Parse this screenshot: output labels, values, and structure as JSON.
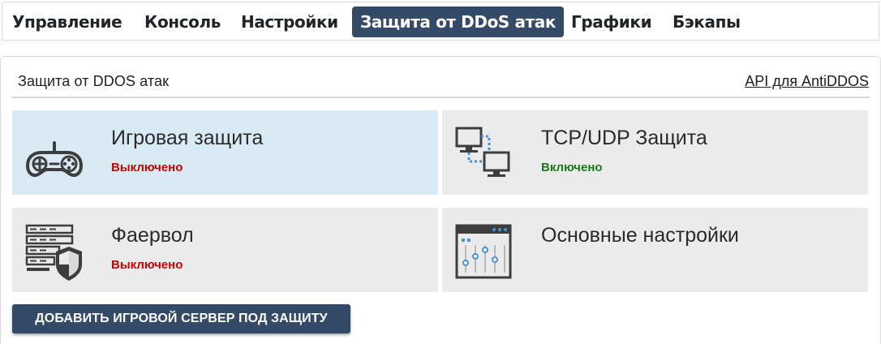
{
  "nav": {
    "items": [
      {
        "label": "Управление"
      },
      {
        "label": "Консоль"
      },
      {
        "label": "Настройки"
      },
      {
        "label": "Защита от DDoS атак",
        "active": true
      },
      {
        "label": "Графики"
      },
      {
        "label": "Бэкапы"
      }
    ]
  },
  "panel": {
    "title": "Защита от DDOS атак",
    "api_link": "API для AntiDDOS"
  },
  "tiles": [
    {
      "title": "Игровая защита",
      "status": "Выключено",
      "icon": "gamepad-icon",
      "highlighted": true
    },
    {
      "title": "TCP/UDP Защита",
      "status": "Включено",
      "icon": "network-computers-icon"
    },
    {
      "title": "Фаервол",
      "status": "Выключено",
      "icon": "firewall-shield-icon"
    },
    {
      "title": "Основные настройки",
      "icon": "settings-sliders-icon"
    }
  ],
  "add_button": {
    "label": "ДОБАВИТЬ ИГРОВОЙ СЕРВЕР ПОД ЗАЩИТУ"
  },
  "colors": {
    "accent": "#344b67",
    "tile_bg": "#ebebeb",
    "tile_highlight": "#d8ebf5",
    "status_off": "#cc0000",
    "status_on": "#1a7a1a"
  }
}
